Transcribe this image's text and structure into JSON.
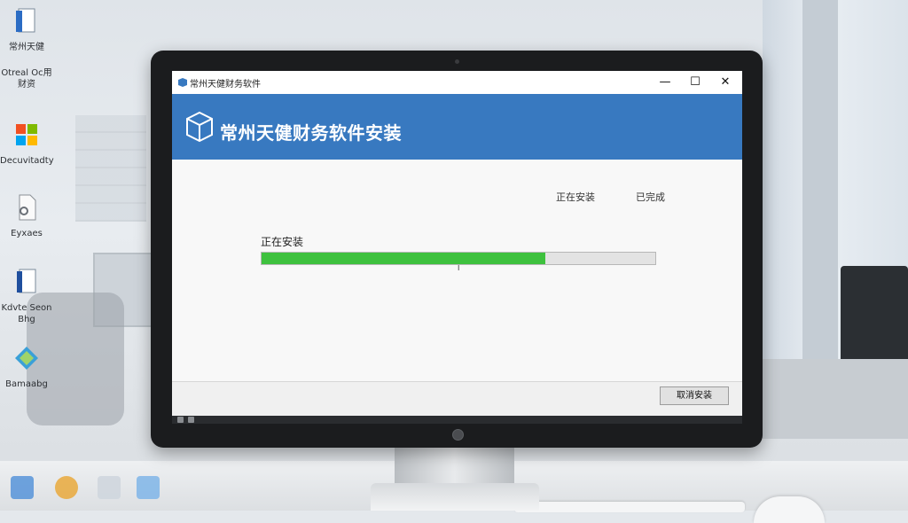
{
  "desktop": {
    "icons": [
      {
        "label": "常州天健",
        "icon": "document-icon"
      },
      {
        "label": "Otreal Oc用财资",
        "icon": "document-icon"
      },
      {
        "label": "Decuvitadty",
        "icon": "windows-logo-icon"
      },
      {
        "label": "Eyxaes",
        "icon": "settings-document-icon"
      },
      {
        "label": "Kdvte Seon Bhg",
        "icon": "document-icon"
      },
      {
        "label": "Bamaabg",
        "icon": "map-icon"
      }
    ]
  },
  "window": {
    "title": "常州天健财务软件",
    "controls": {
      "minimize": "—",
      "maximize": "☐",
      "close": "✕"
    }
  },
  "banner": {
    "title": "常州天健财务软件安装",
    "icon": "box-icon",
    "background": "#3879c0"
  },
  "columns": {
    "left": "正在安装",
    "right": "已完成"
  },
  "install": {
    "status": "正在安装",
    "progress_percent": 72,
    "bar_color": "#3ec13e"
  },
  "footer": {
    "cancel_label": "取消安装"
  }
}
